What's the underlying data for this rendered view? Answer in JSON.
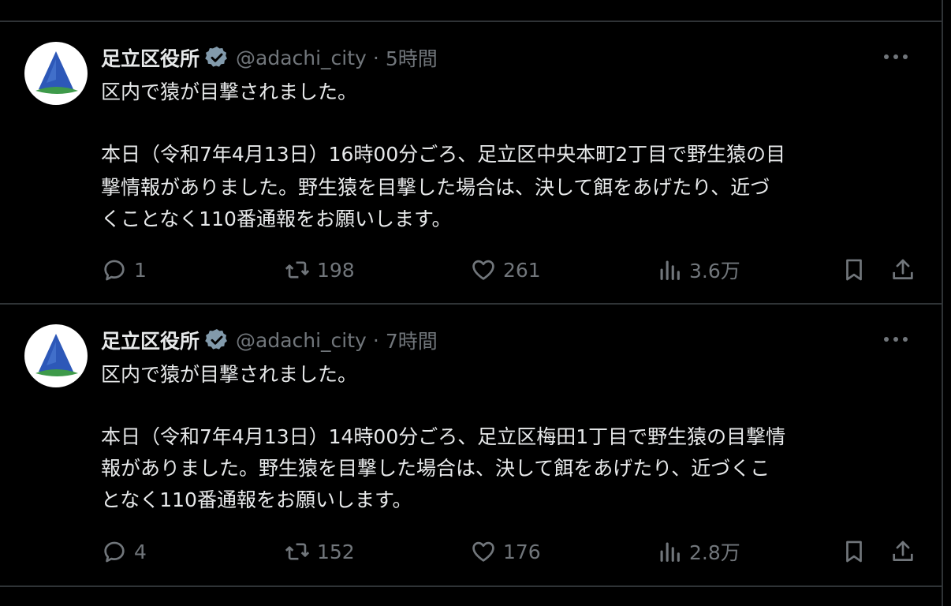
{
  "colors": {
    "background": "#000000",
    "text": "#e7e9ea",
    "muted": "#71767b",
    "divider": "#2f3336",
    "logo_blue": "#2d58b8",
    "logo_green": "#3e9a4a"
  },
  "tweets": [
    {
      "name": "足立区役所",
      "handle": "@adachi_city",
      "separator": "·",
      "time": "5時間",
      "lines": [
        "区内で猿が目撃されました。",
        "",
        "本日（令和7年4月13日）16時00分ごろ、足立区中央本町2丁目で野生猿の目",
        "撃情報がありました。野生猿を目撃した場合は、決して餌をあげたり、近づ",
        "くことなく110番通報をお願いします。"
      ],
      "replies": "1",
      "retweets": "198",
      "likes": "261",
      "views": "3.6万"
    },
    {
      "name": "足立区役所",
      "handle": "@adachi_city",
      "separator": "·",
      "time": "7時間",
      "lines": [
        "区内で猿が目撃されました。",
        "",
        "本日（令和7年4月13日）14時00分ごろ、足立区梅田1丁目で野生猿の目撃情",
        "報がありました。野生猿を目撃した場合は、決して餌をあげたり、近づくこ",
        "となく110番通報をお願いします。"
      ],
      "replies": "4",
      "retweets": "152",
      "likes": "176",
      "views": "2.8万"
    }
  ]
}
